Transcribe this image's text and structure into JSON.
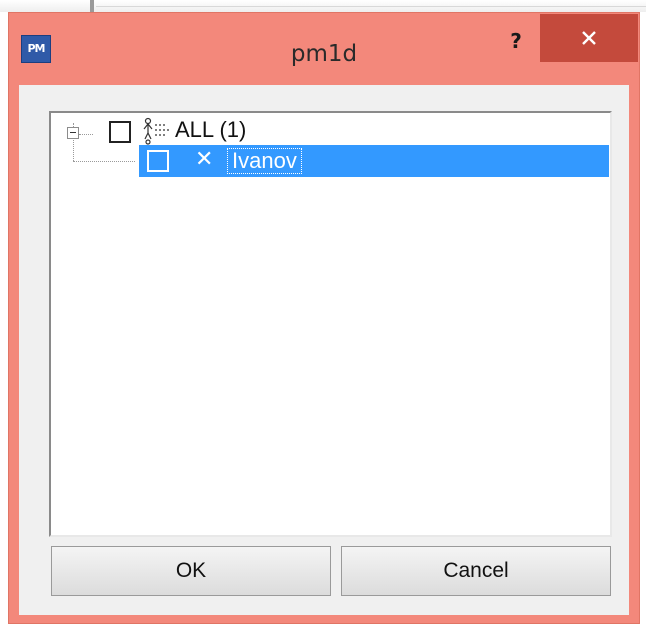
{
  "window": {
    "title": "pm1d",
    "app_icon_text": "PM",
    "help_label": "?",
    "accent_color": "#f3887b",
    "close_color": "#c44a3c"
  },
  "tree": {
    "root": {
      "label": "ALL (1)",
      "checked": false,
      "expanded": true,
      "icon": "user-group-icon"
    },
    "children": [
      {
        "label": "Ivanov",
        "checked": false,
        "selected": true,
        "icon": "x-icon",
        "status_glyph": "✕"
      }
    ],
    "selection_color": "#3399ff"
  },
  "buttons": {
    "ok_label": "OK",
    "cancel_label": "Cancel"
  }
}
